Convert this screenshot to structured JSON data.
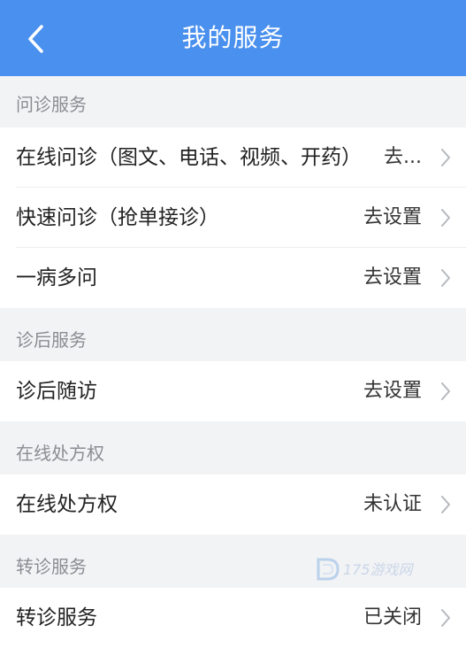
{
  "header": {
    "title": "我的服务",
    "back_icon": "chevron-left-icon",
    "background_color": "#4a90ee"
  },
  "sections": [
    {
      "title": "问诊服务",
      "rows": [
        {
          "label": "在线问诊（图文、电话、视频、开药）",
          "value": "去..."
        },
        {
          "label": "快速问诊（抢单接诊）",
          "value": "去设置"
        },
        {
          "label": "一病多问",
          "value": "去设置"
        }
      ]
    },
    {
      "title": "诊后服务",
      "rows": [
        {
          "label": "诊后随访",
          "value": "去设置"
        }
      ]
    },
    {
      "title": "在线处方权",
      "rows": [
        {
          "label": "在线处方权",
          "value": "未认证"
        }
      ]
    },
    {
      "title": "转诊服务",
      "rows": [
        {
          "label": "转诊服务",
          "value": "已关闭"
        }
      ]
    }
  ],
  "watermark": {
    "text": "175游戏网"
  }
}
